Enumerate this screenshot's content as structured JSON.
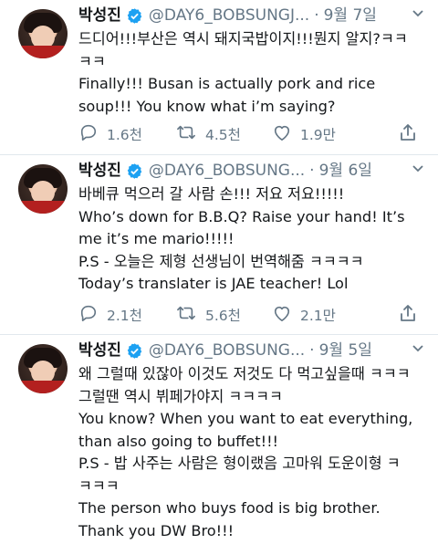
{
  "tweets": [
    {
      "name": "박성진",
      "handle": "@DAY6_BOBSUNGJ...",
      "date": "9월 7일",
      "lines": [
        "드디어!!!부산은 역시 돼지국밥이지!!!뭔지 알지?ㅋㅋ",
        "ㅋㅋ",
        "Finally!!! Busan is actually pork and rice",
        "soup!!! You know what i’m saying?"
      ],
      "replies": "1.6천",
      "retweets": "4.5천",
      "likes": "1.9만"
    },
    {
      "name": "박성진",
      "handle": "@DAY6_BOBSUNG...",
      "date": "9월 6일",
      "lines": [
        "바베큐 먹으러 갈 사람 손!!! 저요 저요!!!!!",
        "Who’s down for B.B.Q? Raise your hand! It’s",
        "me it’s me mario!!!!!",
        "P.S - 오늘은 제형 선생님이 번역해줌 ㅋㅋㅋㅋ",
        "Today’s translater is JAE teacher! Lol"
      ],
      "replies": "2.1천",
      "retweets": "5.6천",
      "likes": "2.1만"
    },
    {
      "name": "박성진",
      "handle": "@DAY6_BOBSUNG...",
      "date": "9월 5일",
      "lines": [
        "왜 그럴때 있잖아 이것도 저것도 다 먹고싶을때 ㅋㅋㅋ",
        "그럴땐 역시 뷔페가야지 ㅋㅋㅋㅋ",
        "You know? When you want to eat everything,",
        "than also going to buffet!!!",
        "P.S - 밥 사주는 사람은 형이랬음 고마워 도운이형 ㅋ",
        "ㅋㅋㅋ",
        "The person who buys food is big brother.",
        "Thank you DW Bro!!!"
      ]
    }
  ],
  "colors": {
    "verified": "#1da1f2",
    "muted": "#657786",
    "divider": "#e1e8ed"
  }
}
